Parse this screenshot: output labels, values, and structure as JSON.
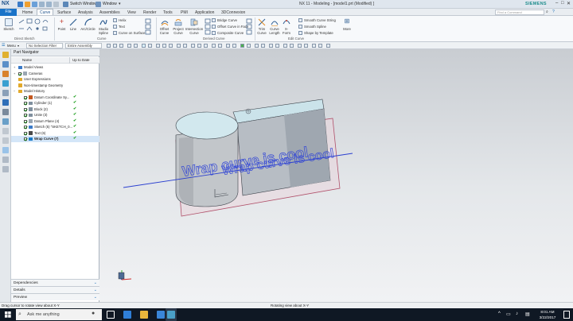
{
  "titlebar": {
    "app_logo": "NX",
    "switch_window": "Switch Window",
    "window_menu": "Window",
    "title": "NX 11 - Modeling - [model1.prt (Modified) ]",
    "brand": "SIEMENS",
    "window_controls": [
      "–",
      "□",
      "✕"
    ]
  },
  "menu": {
    "file": "File",
    "tabs": [
      "Home",
      "Curve",
      "Surface",
      "Analysis",
      "Assemblies",
      "View",
      "Render",
      "Tools",
      "PMI",
      "Application",
      "3DConnexion"
    ],
    "active_tab": "Curve",
    "command_search_placeholder": "Find a Command"
  },
  "ribbon": {
    "direct_sketch": {
      "sketch": "Sketch",
      "label": "Direct Sketch"
    },
    "curve_group": {
      "buttons": [
        "Point",
        "Line",
        "Arc/Circle",
        "Studio Spline"
      ],
      "small": [
        "Helix",
        "Text",
        "Curve on Surface"
      ],
      "label": "Curve"
    },
    "derived_group": {
      "buttons": [
        "Offset Curve",
        "Project Curve",
        "Intersection Curve"
      ],
      "small": [
        "Bridge Curve",
        "Offset Curve in Face",
        "Composite Curve"
      ],
      "label": "Derived Curve"
    },
    "edit_group": {
      "buttons": [
        "Trim Curve",
        "Curve Length",
        "X-Form"
      ],
      "small": [
        "Smooth Curve String",
        "Smooth Spline",
        "Shape by Template"
      ],
      "label": "Edit Curve"
    },
    "more": "More"
  },
  "selection_bar": {
    "menu": "Menu",
    "filter": "No Selection Filter",
    "scope": "Entire Assembly"
  },
  "navigator": {
    "title": "Part Navigator",
    "col_name": "Name",
    "col_status": "Up to Date",
    "status_mark": "✔",
    "items": [
      {
        "label": "Model Views",
        "indent": 0,
        "tri": "+",
        "check": false,
        "uptodate": false,
        "selected": false
      },
      {
        "label": "Cameras",
        "indent": 0,
        "tri": "+",
        "check": true,
        "uptodate": false,
        "selected": false
      },
      {
        "label": "User Expressions",
        "indent": 0,
        "tri": "",
        "check": false,
        "uptodate": false,
        "selected": false
      },
      {
        "label": "Non-timestamp Geometry",
        "indent": 0,
        "tri": "",
        "check": false,
        "uptodate": false,
        "selected": false
      },
      {
        "label": "Model History",
        "indent": 0,
        "tri": "−",
        "check": false,
        "uptodate": false,
        "selected": false
      },
      {
        "label": "Datum Coordinate Sy...",
        "indent": 1,
        "tri": "",
        "check": true,
        "uptodate": true,
        "selected": false
      },
      {
        "label": "Cylinder (1)",
        "indent": 1,
        "tri": "",
        "check": true,
        "uptodate": true,
        "selected": false
      },
      {
        "label": "Block (2)",
        "indent": 1,
        "tri": "",
        "check": true,
        "uptodate": true,
        "selected": false
      },
      {
        "label": "Unite (3)",
        "indent": 1,
        "tri": "",
        "check": true,
        "uptodate": true,
        "selected": false
      },
      {
        "label": "Datum Plane (4)",
        "indent": 1,
        "tri": "",
        "check": true,
        "uptodate": true,
        "selected": false
      },
      {
        "label": "Sketch (5) \"SKETCH_0...",
        "indent": 1,
        "tri": "",
        "check": true,
        "uptodate": true,
        "selected": false
      },
      {
        "label": "Text (6)",
        "indent": 1,
        "tri": "",
        "check": true,
        "uptodate": true,
        "selected": false
      },
      {
        "label": "Wrap Curve (7)",
        "indent": 1,
        "tri": "",
        "check": true,
        "uptodate": true,
        "selected": true
      }
    ],
    "panels": [
      "Dependencies",
      "Details",
      "Preview"
    ]
  },
  "viewport": {
    "wrapped_text_line1": "Wrap curve is cool",
    "wrapped_text_line2": "Wrap curve is cool"
  },
  "status": {
    "left": "Drag cursor to rotate view about X-Y",
    "center": "Rotating view about X-Y"
  },
  "taskbar": {
    "search_placeholder": "Ask me anything",
    "time": "8:01 AM",
    "date": "3/22/2017"
  }
}
